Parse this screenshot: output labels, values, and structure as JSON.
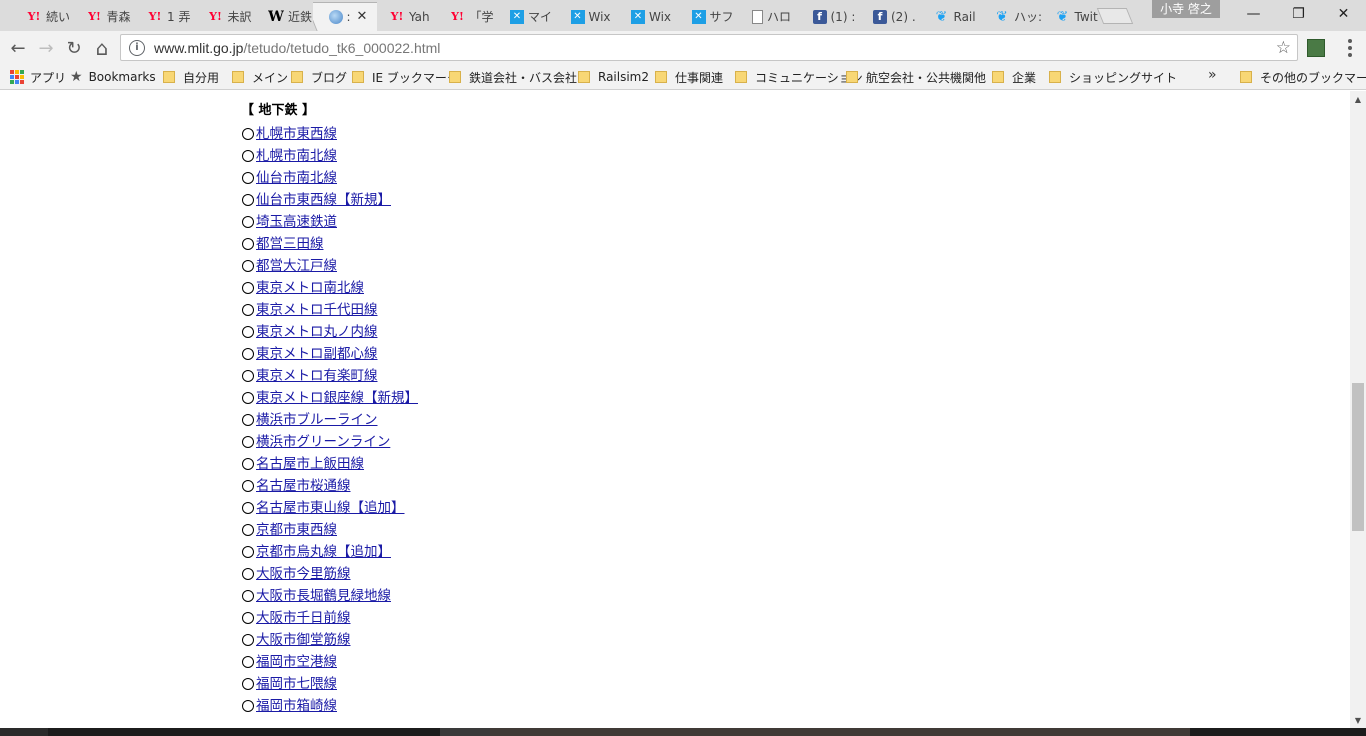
{
  "tabs": [
    {
      "icon": "yahoo",
      "title": "続い"
    },
    {
      "icon": "yahoo",
      "title": "青森"
    },
    {
      "icon": "yahoo",
      "title": "1 弄"
    },
    {
      "icon": "yahoo",
      "title": "未訳"
    },
    {
      "icon": "wiki",
      "title": "近鉄"
    },
    {
      "icon": "globe",
      "title": ":",
      "active": true
    },
    {
      "icon": "yahoo",
      "title": "Yah"
    },
    {
      "icon": "yahoo",
      "title": "「学"
    },
    {
      "icon": "wix",
      "title": "マイ"
    },
    {
      "icon": "wix",
      "title": "Wix"
    },
    {
      "icon": "wix",
      "title": "Wix"
    },
    {
      "icon": "wix",
      "title": "サフ"
    },
    {
      "icon": "doc",
      "title": "ハロ"
    },
    {
      "icon": "fb",
      "title": "(1) :"
    },
    {
      "icon": "fb",
      "title": "(2) ."
    },
    {
      "icon": "tw",
      "title": "Rail"
    },
    {
      "icon": "tw",
      "title": "ハッ:"
    },
    {
      "icon": "tw",
      "title": "Twit"
    }
  ],
  "profile_name": "小寺 啓之",
  "window_controls": {
    "minimize": "—",
    "restore": "❐",
    "close": "✕"
  },
  "nav": {
    "back": "←",
    "forward": "→",
    "reload": "↻",
    "home": "⌂"
  },
  "address": {
    "host": "www.mlit.go.jp",
    "path": "/tetudo/tetudo_tk6_000022.html"
  },
  "bookmarks": [
    {
      "type": "apps",
      "label": "アプリ"
    },
    {
      "type": "star",
      "label": "Bookmarks"
    },
    {
      "type": "folder",
      "label": "自分用"
    },
    {
      "type": "folder",
      "label": "メイン"
    },
    {
      "type": "folder",
      "label": "ブログ"
    },
    {
      "type": "folder",
      "label": "IE ブックマーク"
    },
    {
      "type": "folder",
      "label": "鉄道会社・バス会社"
    },
    {
      "type": "folder",
      "label": "Railsim2"
    },
    {
      "type": "folder",
      "label": "仕事関連"
    },
    {
      "type": "folder",
      "label": "コミュニケーション"
    },
    {
      "type": "folder",
      "label": "航空会社・公共機関他"
    },
    {
      "type": "folder",
      "label": "企業"
    },
    {
      "type": "folder",
      "label": "ショッピングサイト"
    }
  ],
  "bookmarks_more": "»",
  "other_bookmarks": "その他のブックマーク",
  "page": {
    "heading": "【 地下鉄 】",
    "lines": [
      "札幌市東西線",
      "札幌市南北線",
      "仙台市南北線",
      "仙台市東西線【新規】",
      "埼玉高速鉄道",
      "都営三田線",
      "都営大江戸線",
      "東京メトロ南北線",
      "東京メトロ千代田線",
      "東京メトロ丸ノ内線",
      "東京メトロ副都心線",
      "東京メトロ有楽町線",
      "東京メトロ銀座線【新規】",
      "横浜市ブルーライン",
      "横浜市グリーンライン",
      "名古屋市上飯田線",
      "名古屋市桜通線",
      "名古屋市東山線【追加】",
      "京都市東西線",
      "京都市烏丸線【追加】",
      "大阪市今里筋線",
      "大阪市長堀鶴見緑地線",
      "大阪市千日前線",
      "大阪市御堂筋線",
      "福岡市空港線",
      "福岡市七隈線",
      "福岡市箱崎線"
    ]
  }
}
